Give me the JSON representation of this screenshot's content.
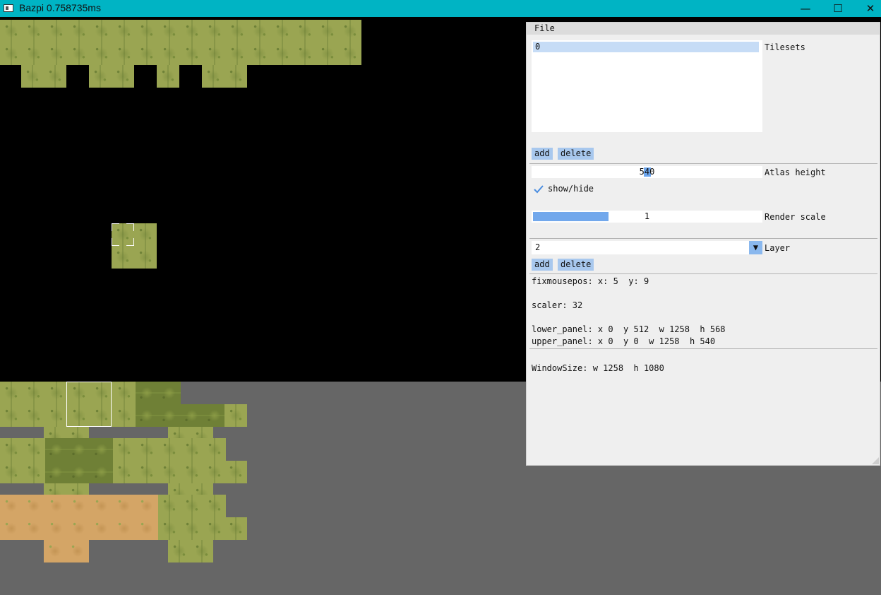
{
  "window": {
    "title": "Bazpi 0.758735ms",
    "minimize_glyph": "—",
    "maximize_glyph": "☐",
    "close_glyph": "✕"
  },
  "menu": {
    "file": "File"
  },
  "tilesets": {
    "items": [
      "0"
    ],
    "label": "Tilesets",
    "add": "add",
    "delete": "delete"
  },
  "atlas": {
    "value": "540",
    "label": "Atlas height"
  },
  "show_hide": {
    "label": "show/hide",
    "checked": true
  },
  "render_scale": {
    "value": "1",
    "label": "Render scale",
    "fill_fraction": 0.33
  },
  "layer": {
    "value": "2",
    "label": "Layer",
    "add": "add",
    "delete": "delete"
  },
  "info": {
    "fixmousepos": "fixmousepos: x: 5  y: 9",
    "scaler": "scaler: 32",
    "lower_panel": "lower_panel: x 0  y 512  w 1258  h 568",
    "upper_panel": "upper_panel: x 0  y 0  w 1258  h 540",
    "window_size": "WindowSize: w 1258  h 1080"
  },
  "colors": {
    "titlebar": "#00b4c4",
    "canvas": "#000000",
    "lower_panel_bg": "#666666",
    "grass": "#9aa552",
    "grass_dark": "#6f8036",
    "sand": "#d4a566",
    "accent": "#a8c8ee"
  },
  "icons": {
    "app": "app-icon",
    "dropdown": "triangle-down-icon",
    "check": "checkmark-icon"
  }
}
